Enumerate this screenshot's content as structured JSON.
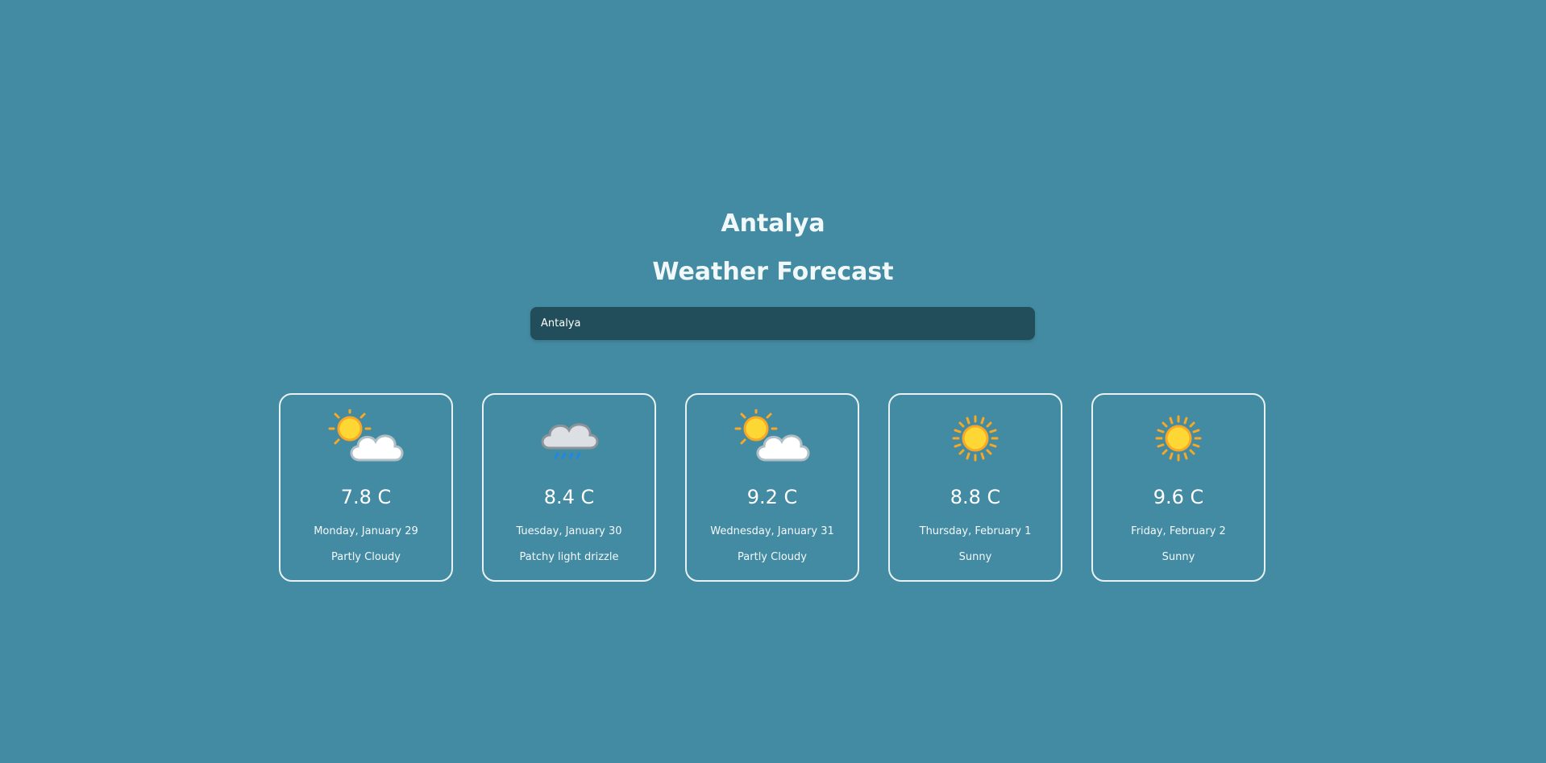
{
  "header": {
    "city": "Antalya",
    "title": "Weather Forecast"
  },
  "search": {
    "value": "Antalya",
    "placeholder": ""
  },
  "colors": {
    "background": "#438ba2",
    "input_background": "#224e5c",
    "card_border": "#e8f2f5",
    "sun": "#fdd835",
    "sun_rays": "#f9a825",
    "cloud": "#ffffff",
    "rain": "#1e88e5"
  },
  "forecast": [
    {
      "temp": "7.8 C",
      "date": "Monday, January 29",
      "condition": "Partly Cloudy",
      "icon": "partly-cloudy-icon"
    },
    {
      "temp": "8.4 C",
      "date": "Tuesday, January 30",
      "condition": "Patchy light drizzle",
      "icon": "drizzle-cloud-icon"
    },
    {
      "temp": "9.2 C",
      "date": "Wednesday, January 31",
      "condition": "Partly Cloudy",
      "icon": "partly-cloudy-icon"
    },
    {
      "temp": "8.8 C",
      "date": "Thursday, February 1",
      "condition": "Sunny",
      "icon": "sun-icon"
    },
    {
      "temp": "9.6 C",
      "date": "Friday, February 2",
      "condition": "Sunny",
      "icon": "sun-icon"
    }
  ]
}
